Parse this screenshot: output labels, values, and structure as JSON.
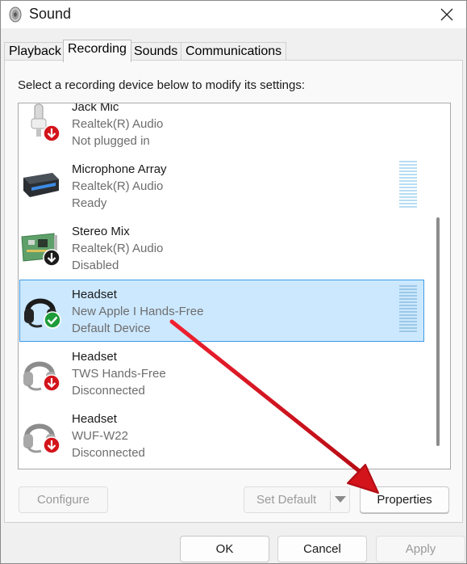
{
  "window": {
    "title": "Sound"
  },
  "tabs": [
    {
      "label": "Playback"
    },
    {
      "label": "Recording"
    },
    {
      "label": "Sounds"
    },
    {
      "label": "Communications"
    }
  ],
  "instruction": "Select a recording device below to modify its settings:",
  "devices": [
    {
      "name": "Jack Mic",
      "driver": "Realtek(R) Audio",
      "status": "Not plugged in",
      "icon": "microphone-jack-icon",
      "badge": "red-down-arrow"
    },
    {
      "name": "Microphone Array",
      "driver": "Realtek(R) Audio",
      "status": "Ready",
      "icon": "microphone-array-icon",
      "badge": "none"
    },
    {
      "name": "Stereo Mix",
      "driver": "Realtek(R) Audio",
      "status": "Disabled",
      "icon": "sound-card-icon",
      "badge": "black-down-arrow"
    },
    {
      "name": "Headset",
      "driver": "New Apple I Hands-Free",
      "status": "Default Device",
      "icon": "headset-icon",
      "badge": "green-check"
    },
    {
      "name": "Headset",
      "driver": "TWS Hands-Free",
      "status": "Disconnected",
      "icon": "headset-icon",
      "badge": "red-down-arrow"
    },
    {
      "name": "Headset",
      "driver": "WUF-W22",
      "status": "Disconnected",
      "icon": "headset-icon",
      "badge": "red-down-arrow"
    }
  ],
  "buttons": {
    "configure": "Configure",
    "set_default": "Set Default",
    "properties": "Properties",
    "ok": "OK",
    "cancel": "Cancel",
    "apply": "Apply"
  },
  "colors": {
    "selection_bg": "#cce8ff",
    "selection_border": "#3b9be8",
    "annotation_arrow": "#e0141e",
    "default_badge": "#1f9c3a",
    "error_badge": "#d3141b"
  }
}
